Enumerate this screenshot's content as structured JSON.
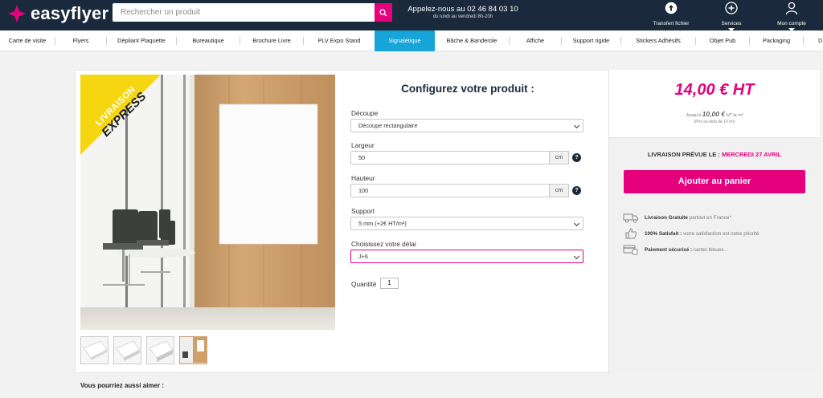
{
  "brand": {
    "name": "easyflyer",
    "color": "#e5007e"
  },
  "search": {
    "placeholder": "Rechercher un produit",
    "icon": "search-icon"
  },
  "contact": {
    "phone_line": "Appelez-nous au 02 46 84 03 10",
    "hours": "du lundi au vendredi 8h-20h"
  },
  "header_buttons": [
    {
      "label": "Transfert fichier",
      "icon": "upload-icon"
    },
    {
      "label": "Services",
      "icon": "plus-circle-icon"
    },
    {
      "label": "Mon compte",
      "icon": "user-icon"
    }
  ],
  "nav": {
    "items": [
      "Carte de visite",
      "Flyers",
      "Dépliant Plaquette",
      "Bureautique",
      "Brochure Livre",
      "PLV Expo Stand",
      "Signalétique",
      "Bâche & Banderole",
      "Affiche",
      "Support rigide",
      "Stickers Adhésifs",
      "Objet Pub",
      "Packaging",
      "D"
    ],
    "active": "Signalétique",
    "active_color": "#16a4d9"
  },
  "product": {
    "badge_line1": "LIVRAISON",
    "badge_line2": "EXPRESS"
  },
  "config": {
    "title": "Configurez votre produit :",
    "decoupe_label": "Découpe",
    "decoupe_value": "Découpe rectangulaire",
    "largeur_label": "Largeur",
    "largeur_value": "50",
    "hauteur_label": "Hauteur",
    "hauteur_value": "100",
    "unit": "cm",
    "help": "?",
    "support_label": "Support",
    "support_value": "5 mm (+2€ HT/m²)",
    "delai_label": "Choisissez votre délai",
    "delai_value": "J+6",
    "quantite_label": "Quantité",
    "quantite_value": "1"
  },
  "pricing": {
    "price": "14,00 € HT",
    "from_prefix": "Jusqu'à",
    "from_price": "10,00 €",
    "from_suffix": "HT le m²",
    "from_note": "(Prix au-delà de 10 m²)"
  },
  "delivery": {
    "label": "LIVRAISON PRÉVUE LE :",
    "date": "MERCREDI 27 AVRIL"
  },
  "cart": {
    "label": "Ajouter au panier"
  },
  "perks": [
    {
      "bold": "Livraison Gratuite",
      "text": " partout en France*",
      "icon": "truck-icon"
    },
    {
      "bold": "100% Satisfait :",
      "text": " votre satisfaction est notre priorité",
      "icon": "thumbs-up-icon"
    },
    {
      "bold": "Paiement sécurisé :",
      "text": " cartes bleues...",
      "icon": "secure-payment-icon"
    }
  ],
  "also": "Vous pourriez aussi aimer :"
}
